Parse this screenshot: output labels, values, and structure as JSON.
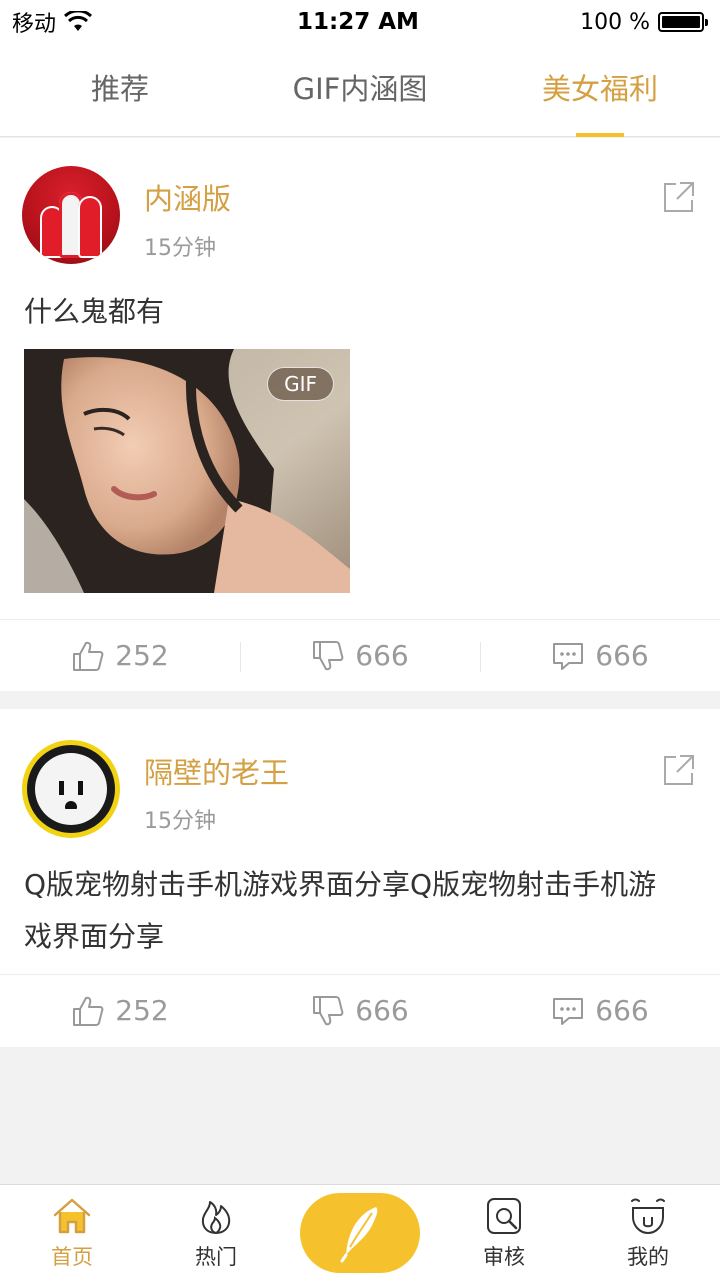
{
  "status_bar": {
    "carrier": "移动",
    "time": "11:27 AM",
    "battery": "100 %"
  },
  "tabs": [
    {
      "label": "推荐",
      "active": false
    },
    {
      "label": "GIF内涵图",
      "active": false
    },
    {
      "label": "美女福利",
      "active": true
    }
  ],
  "posts": [
    {
      "username": "内涵版",
      "time": "15分钟",
      "text": "什么鬼都有",
      "media_badge": "GIF",
      "likes": "252",
      "dislikes": "666",
      "comments": "666"
    },
    {
      "username": "隔壁的老王",
      "time": "15分钟",
      "text": "Q版宠物射击手机游戏界面分享Q版宠物射击手机游戏界面分享",
      "likes": "252",
      "dislikes": "666",
      "comments": "666"
    }
  ],
  "bottom_nav": {
    "home": "首页",
    "hot": "热门",
    "review": "审核",
    "mine": "我的"
  },
  "colors": {
    "accent": "#d4a043",
    "tab_indicator": "#f5c02a",
    "post_button": "#f5c22d"
  }
}
